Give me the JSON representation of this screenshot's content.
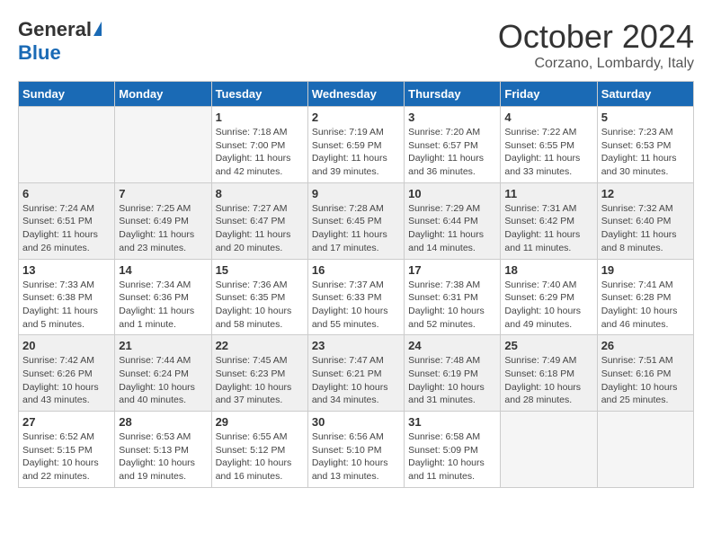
{
  "logo": {
    "general": "General",
    "blue": "Blue"
  },
  "title": "October 2024",
  "location": "Corzano, Lombardy, Italy",
  "days_of_week": [
    "Sunday",
    "Monday",
    "Tuesday",
    "Wednesday",
    "Thursday",
    "Friday",
    "Saturday"
  ],
  "weeks": [
    [
      {
        "day": "",
        "sunrise": "",
        "sunset": "",
        "daylight": ""
      },
      {
        "day": "",
        "sunrise": "",
        "sunset": "",
        "daylight": ""
      },
      {
        "day": "1",
        "sunrise": "Sunrise: 7:18 AM",
        "sunset": "Sunset: 7:00 PM",
        "daylight": "Daylight: 11 hours and 42 minutes."
      },
      {
        "day": "2",
        "sunrise": "Sunrise: 7:19 AM",
        "sunset": "Sunset: 6:59 PM",
        "daylight": "Daylight: 11 hours and 39 minutes."
      },
      {
        "day": "3",
        "sunrise": "Sunrise: 7:20 AM",
        "sunset": "Sunset: 6:57 PM",
        "daylight": "Daylight: 11 hours and 36 minutes."
      },
      {
        "day": "4",
        "sunrise": "Sunrise: 7:22 AM",
        "sunset": "Sunset: 6:55 PM",
        "daylight": "Daylight: 11 hours and 33 minutes."
      },
      {
        "day": "5",
        "sunrise": "Sunrise: 7:23 AM",
        "sunset": "Sunset: 6:53 PM",
        "daylight": "Daylight: 11 hours and 30 minutes."
      }
    ],
    [
      {
        "day": "6",
        "sunrise": "Sunrise: 7:24 AM",
        "sunset": "Sunset: 6:51 PM",
        "daylight": "Daylight: 11 hours and 26 minutes."
      },
      {
        "day": "7",
        "sunrise": "Sunrise: 7:25 AM",
        "sunset": "Sunset: 6:49 PM",
        "daylight": "Daylight: 11 hours and 23 minutes."
      },
      {
        "day": "8",
        "sunrise": "Sunrise: 7:27 AM",
        "sunset": "Sunset: 6:47 PM",
        "daylight": "Daylight: 11 hours and 20 minutes."
      },
      {
        "day": "9",
        "sunrise": "Sunrise: 7:28 AM",
        "sunset": "Sunset: 6:45 PM",
        "daylight": "Daylight: 11 hours and 17 minutes."
      },
      {
        "day": "10",
        "sunrise": "Sunrise: 7:29 AM",
        "sunset": "Sunset: 6:44 PM",
        "daylight": "Daylight: 11 hours and 14 minutes."
      },
      {
        "day": "11",
        "sunrise": "Sunrise: 7:31 AM",
        "sunset": "Sunset: 6:42 PM",
        "daylight": "Daylight: 11 hours and 11 minutes."
      },
      {
        "day": "12",
        "sunrise": "Sunrise: 7:32 AM",
        "sunset": "Sunset: 6:40 PM",
        "daylight": "Daylight: 11 hours and 8 minutes."
      }
    ],
    [
      {
        "day": "13",
        "sunrise": "Sunrise: 7:33 AM",
        "sunset": "Sunset: 6:38 PM",
        "daylight": "Daylight: 11 hours and 5 minutes."
      },
      {
        "day": "14",
        "sunrise": "Sunrise: 7:34 AM",
        "sunset": "Sunset: 6:36 PM",
        "daylight": "Daylight: 11 hours and 1 minute."
      },
      {
        "day": "15",
        "sunrise": "Sunrise: 7:36 AM",
        "sunset": "Sunset: 6:35 PM",
        "daylight": "Daylight: 10 hours and 58 minutes."
      },
      {
        "day": "16",
        "sunrise": "Sunrise: 7:37 AM",
        "sunset": "Sunset: 6:33 PM",
        "daylight": "Daylight: 10 hours and 55 minutes."
      },
      {
        "day": "17",
        "sunrise": "Sunrise: 7:38 AM",
        "sunset": "Sunset: 6:31 PM",
        "daylight": "Daylight: 10 hours and 52 minutes."
      },
      {
        "day": "18",
        "sunrise": "Sunrise: 7:40 AM",
        "sunset": "Sunset: 6:29 PM",
        "daylight": "Daylight: 10 hours and 49 minutes."
      },
      {
        "day": "19",
        "sunrise": "Sunrise: 7:41 AM",
        "sunset": "Sunset: 6:28 PM",
        "daylight": "Daylight: 10 hours and 46 minutes."
      }
    ],
    [
      {
        "day": "20",
        "sunrise": "Sunrise: 7:42 AM",
        "sunset": "Sunset: 6:26 PM",
        "daylight": "Daylight: 10 hours and 43 minutes."
      },
      {
        "day": "21",
        "sunrise": "Sunrise: 7:44 AM",
        "sunset": "Sunset: 6:24 PM",
        "daylight": "Daylight: 10 hours and 40 minutes."
      },
      {
        "day": "22",
        "sunrise": "Sunrise: 7:45 AM",
        "sunset": "Sunset: 6:23 PM",
        "daylight": "Daylight: 10 hours and 37 minutes."
      },
      {
        "day": "23",
        "sunrise": "Sunrise: 7:47 AM",
        "sunset": "Sunset: 6:21 PM",
        "daylight": "Daylight: 10 hours and 34 minutes."
      },
      {
        "day": "24",
        "sunrise": "Sunrise: 7:48 AM",
        "sunset": "Sunset: 6:19 PM",
        "daylight": "Daylight: 10 hours and 31 minutes."
      },
      {
        "day": "25",
        "sunrise": "Sunrise: 7:49 AM",
        "sunset": "Sunset: 6:18 PM",
        "daylight": "Daylight: 10 hours and 28 minutes."
      },
      {
        "day": "26",
        "sunrise": "Sunrise: 7:51 AM",
        "sunset": "Sunset: 6:16 PM",
        "daylight": "Daylight: 10 hours and 25 minutes."
      }
    ],
    [
      {
        "day": "27",
        "sunrise": "Sunrise: 6:52 AM",
        "sunset": "Sunset: 5:15 PM",
        "daylight": "Daylight: 10 hours and 22 minutes."
      },
      {
        "day": "28",
        "sunrise": "Sunrise: 6:53 AM",
        "sunset": "Sunset: 5:13 PM",
        "daylight": "Daylight: 10 hours and 19 minutes."
      },
      {
        "day": "29",
        "sunrise": "Sunrise: 6:55 AM",
        "sunset": "Sunset: 5:12 PM",
        "daylight": "Daylight: 10 hours and 16 minutes."
      },
      {
        "day": "30",
        "sunrise": "Sunrise: 6:56 AM",
        "sunset": "Sunset: 5:10 PM",
        "daylight": "Daylight: 10 hours and 13 minutes."
      },
      {
        "day": "31",
        "sunrise": "Sunrise: 6:58 AM",
        "sunset": "Sunset: 5:09 PM",
        "daylight": "Daylight: 10 hours and 11 minutes."
      },
      {
        "day": "",
        "sunrise": "",
        "sunset": "",
        "daylight": ""
      },
      {
        "day": "",
        "sunrise": "",
        "sunset": "",
        "daylight": ""
      }
    ]
  ]
}
